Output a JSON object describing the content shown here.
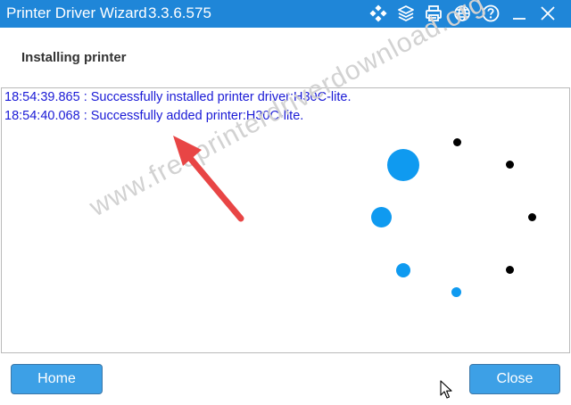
{
  "titlebar": {
    "title": "Printer Driver Wizard",
    "version": "3.3.6.575",
    "icons": [
      "apps-icon",
      "layers-icon",
      "printer-icon",
      "globe-icon",
      "help-icon",
      "minimize-icon",
      "close-icon"
    ]
  },
  "header": {
    "title": "Installing printer"
  },
  "log": {
    "lines": [
      "18:54:39.865 : Successfully installed printer driver:H30C-lite.",
      "18:54:40.068 : Successfully added printer:H30C-lite."
    ]
  },
  "watermark": "www.freeprinterdriverdownload.org",
  "footer": {
    "home_label": "Home",
    "close_label": "Close"
  },
  "colors": {
    "titlebar": "#1f86d8",
    "log_text": "#1a1ad6",
    "button": "#3da0e6",
    "spinner_active": "#0f9af0",
    "spinner_inactive": "#000000",
    "annotation_arrow": "#e84545"
  }
}
